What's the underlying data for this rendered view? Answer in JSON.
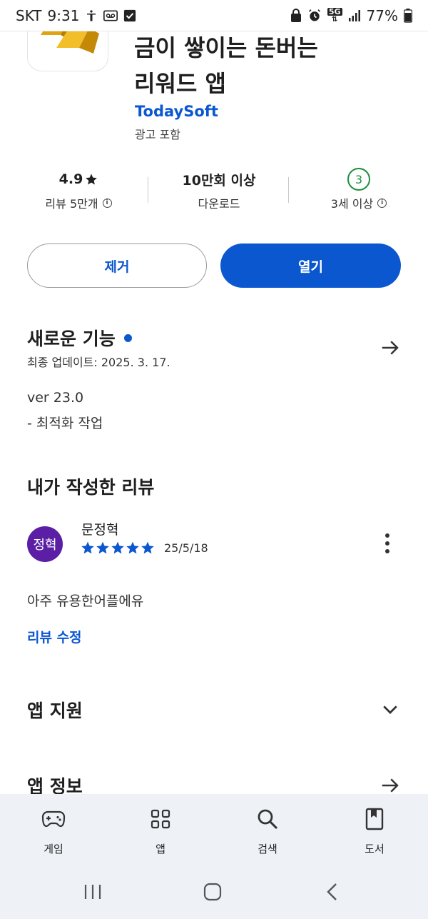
{
  "status_bar": {
    "carrier": "SKT",
    "time": "9:31",
    "network": "5G",
    "battery": "77%"
  },
  "app": {
    "title_line1": "금이 쌓이는 돈버는",
    "title_line2": "리워드 앱",
    "developer": "TodaySoft",
    "ads_note": "광고 포함"
  },
  "stats": {
    "rating": "4.9",
    "rating_label": "리뷰 5만개",
    "downloads": "10만회 이상",
    "downloads_label": "다운로드",
    "age_badge": "3",
    "age_label": "3세 이상"
  },
  "actions": {
    "remove_label": "제거",
    "open_label": "열기"
  },
  "whats_new": {
    "title": "새로운 기능",
    "updated": "최종 업데이트: 2025. 3. 17.",
    "version": "ver 23.0",
    "note": "- 최적화 작업"
  },
  "my_review": {
    "title": "내가 작성한 리뷰",
    "avatar_text": "정혁",
    "reviewer": "문정혁",
    "stars": 5,
    "date": "25/5/18",
    "text": "아주 유용한어플에유",
    "edit_label": "리뷰 수정"
  },
  "sections": {
    "app_support": "앱 지원",
    "app_info": "앱 정보"
  },
  "bottom_nav": [
    {
      "label": "게임",
      "icon": "gamepad-icon"
    },
    {
      "label": "앱",
      "icon": "apps-grid-icon"
    },
    {
      "label": "검색",
      "icon": "search-icon"
    },
    {
      "label": "도서",
      "icon": "book-icon"
    }
  ],
  "colors": {
    "accent": "#0b57d0",
    "avatar": "#5b1fa6",
    "age_green": "#1e8e3e",
    "nav_bg": "#eef1f6"
  }
}
